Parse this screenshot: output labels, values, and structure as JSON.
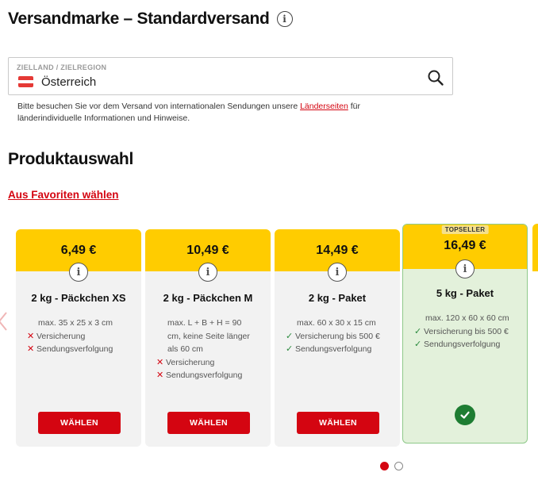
{
  "header": {
    "title": "Versandmarke – Standardversand",
    "info_icon": "info-icon"
  },
  "destination": {
    "label": "ZIELLAND / ZIELREGION",
    "value": "Österreich",
    "flag_colors": [
      "#e53935",
      "#ffffff",
      "#e53935"
    ],
    "search_icon": "search-icon"
  },
  "note": {
    "text_before": "Bitte besuchen Sie vor dem Versand von internationalen Sendungen unsere ",
    "link": "Länderseiten",
    "text_after": " für länderindividuelle Informationen und Hinweise."
  },
  "section": {
    "title": "Produktauswahl",
    "favorites_link": "Aus Favoriten wählen"
  },
  "products": [
    {
      "price": "6,49 €",
      "name": "2 kg - Päckchen XS",
      "dims": "max. 35 x 25 x 3 cm",
      "features": [
        {
          "text": "Versicherung",
          "included": false
        },
        {
          "text": "Sendungsverfolgung",
          "included": false
        }
      ],
      "button": "WÄHLEN"
    },
    {
      "price": "10,49 €",
      "name": "2 kg - Päckchen M",
      "dims": "max. L + B + H = 90 cm, keine Seite länger als 60 cm",
      "features": [
        {
          "text": "Versicherung",
          "included": false
        },
        {
          "text": "Sendungsverfolgung",
          "included": false
        }
      ],
      "button": "WÄHLEN"
    },
    {
      "price": "14,49 €",
      "name": "2 kg - Paket",
      "dims": "max. 60 x 30 x 15 cm",
      "features": [
        {
          "text": "Versicherung bis 500 €",
          "included": true
        },
        {
          "text": "Sendungsverfolgung",
          "included": true
        }
      ],
      "button": "WÄHLEN"
    },
    {
      "price": "16,49 €",
      "name": "5 kg - Paket",
      "dims": "max. 120 x 60 x 60 cm",
      "badge": "TOPSELLER",
      "selected": true,
      "features": [
        {
          "text": "Versicherung bis 500 €",
          "included": true
        },
        {
          "text": "Sendungsverfolgung",
          "included": true
        }
      ]
    }
  ],
  "pagination": {
    "current": 1,
    "total": 2
  },
  "colors": {
    "brand_yellow": "#ffcc00",
    "brand_red": "#d40511",
    "selected_bg": "#e3f1db",
    "check_green": "#1e7d32"
  }
}
